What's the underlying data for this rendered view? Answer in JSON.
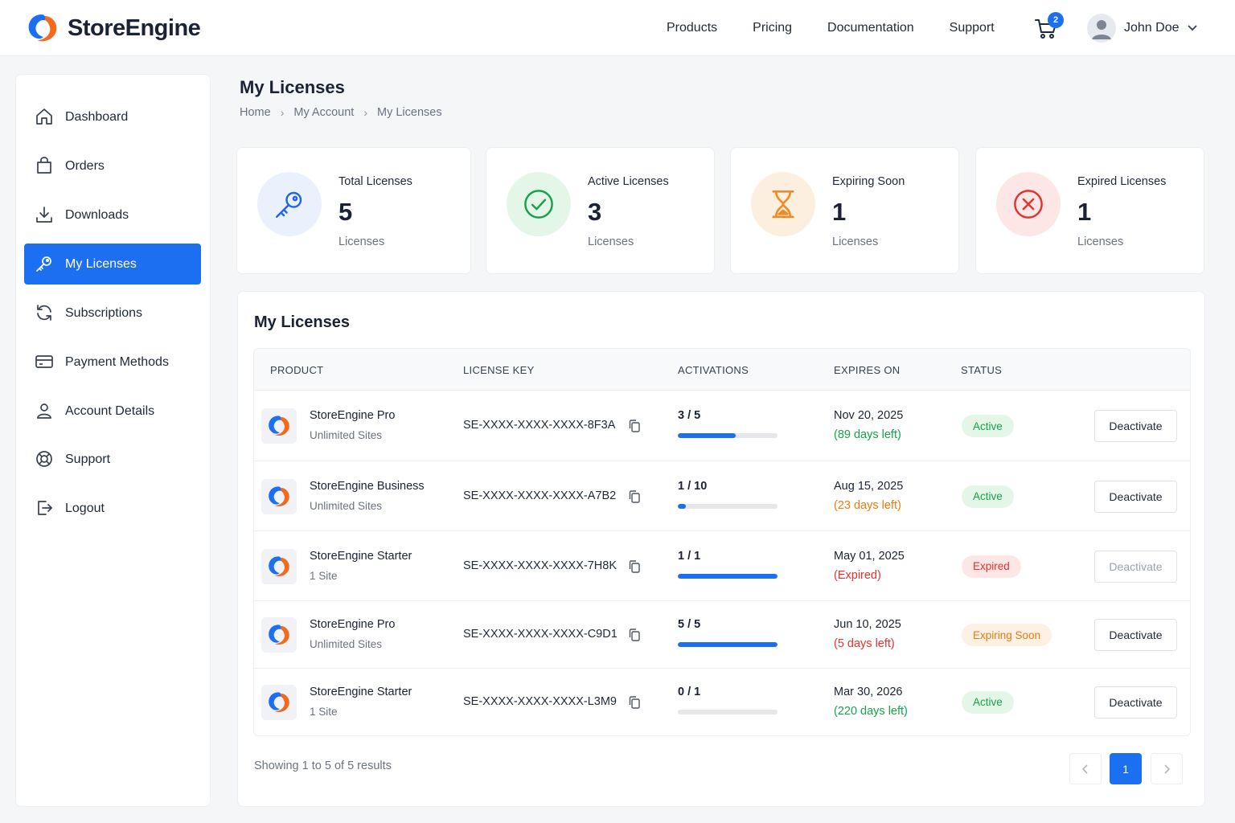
{
  "header": {
    "brand": "StoreEngine",
    "nav": [
      "Products",
      "Pricing",
      "Documentation",
      "Support"
    ],
    "cart_count": "2",
    "user_name": "John Doe"
  },
  "sidebar": {
    "items": [
      {
        "label": "Dashboard",
        "icon": "home-icon"
      },
      {
        "label": "Orders",
        "icon": "bag-icon"
      },
      {
        "label": "Downloads",
        "icon": "download-icon"
      },
      {
        "label": "My Licenses",
        "icon": "key-icon",
        "active": true
      },
      {
        "label": "Subscriptions",
        "icon": "refresh-icon"
      },
      {
        "label": "Payment Methods",
        "icon": "credit-card-icon"
      },
      {
        "label": "Account Details",
        "icon": "user-icon"
      },
      {
        "label": "Support",
        "icon": "lifebuoy-icon"
      },
      {
        "label": "Logout",
        "icon": "logout-icon"
      }
    ]
  },
  "page": {
    "title": "My Licenses",
    "breadcrumb": [
      "Home",
      "My Account",
      "My Licenses"
    ]
  },
  "stats": [
    {
      "title": "Total Licenses",
      "value": "5",
      "sub": "Licenses",
      "icon": "key-icon",
      "color": "#2563eb",
      "bg": "#eaf1fd"
    },
    {
      "title": "Active Licenses",
      "value": "3",
      "sub": "Licenses",
      "icon": "check-circle-icon",
      "color": "#16a34a",
      "bg": "#e3f6e8"
    },
    {
      "title": "Expiring Soon",
      "value": "1",
      "sub": "Licenses",
      "icon": "hourglass-icon",
      "color": "#f08a24",
      "bg": "#fdefdf"
    },
    {
      "title": "Expired Licenses",
      "value": "1",
      "sub": "Licenses",
      "icon": "x-circle-icon",
      "color": "#e5322d",
      "bg": "#fde6e6"
    }
  ],
  "licenses": {
    "title": "My Licenses",
    "columns": [
      "PRODUCT",
      "LICENSE KEY",
      "ACTIVATIONS",
      "EXPIRES ON",
      "STATUS"
    ],
    "rows": [
      {
        "product": "StoreEngine Pro",
        "plan": "Unlimited Sites",
        "key": "SE-XXXX-XXXX-XXXX-8F3A",
        "activations": "3 / 5",
        "progress": 0.58,
        "expires": "Nov 20, 2025",
        "remaining": "(89 days left)",
        "remaining_color": "#16a34a",
        "status": "Active",
        "status_type": "active",
        "action": "Deactivate",
        "action_disabled": false
      },
      {
        "product": "StoreEngine Business",
        "plan": "Unlimited Sites",
        "key": "SE-XXXX-XXXX-XXXX-A7B2",
        "activations": "1 / 10",
        "progress": 0.08,
        "expires": "Aug 15, 2025",
        "remaining": "(23 days left)",
        "remaining_color": "#ea7a12",
        "status": "Active",
        "status_type": "active",
        "action": "Deactivate",
        "action_disabled": false
      },
      {
        "product": "StoreEngine Starter",
        "plan": "1 Site",
        "key": "SE-XXXX-XXXX-XXXX-7H8K",
        "activations": "1 / 1",
        "progress": 1.0,
        "expires": "May 01, 2025",
        "remaining": "(Expired)",
        "remaining_color": "#e5322d",
        "status": "Expired",
        "status_type": "expired",
        "action": "Deactivate",
        "action_disabled": true
      },
      {
        "product": "StoreEngine Pro",
        "plan": "Unlimited Sites",
        "key": "SE-XXXX-XXXX-XXXX-C9D1",
        "activations": "5 / 5",
        "progress": 1.0,
        "expires": "Jun 10, 2025",
        "remaining": "(5 days left)",
        "remaining_color": "#e5322d",
        "status": "Expiring Soon",
        "status_type": "expiring",
        "action": "Deactivate",
        "action_disabled": false
      },
      {
        "product": "StoreEngine Starter",
        "plan": "1 Site",
        "key": "SE-XXXX-XXXX-XXXX-L3M9",
        "activations": "0 / 1",
        "progress": 0.0,
        "expires": "Mar 30, 2026",
        "remaining": "(220 days left)",
        "remaining_color": "#16a34a",
        "status": "Active",
        "status_type": "active",
        "action": "Deactivate",
        "action_disabled": false
      }
    ],
    "showing": "Showing 1 to 5 of 5 results",
    "current_page": "1"
  }
}
